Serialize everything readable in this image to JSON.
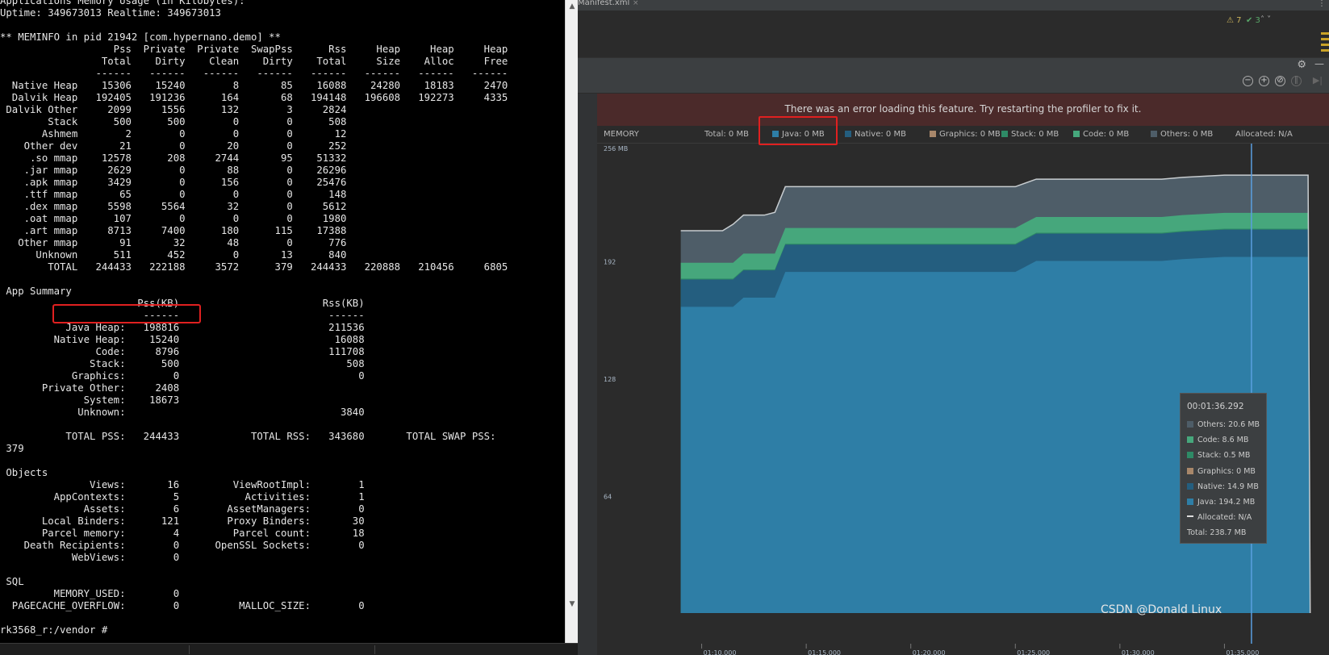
{
  "terminal": {
    "lines": [
      "Applications Memory Usage (in Kilobytes):",
      "Uptime: 349673013 Realtime: 349673013",
      "",
      "** MEMINFO in pid 21942 [com.hypernano.demo] **",
      "                   Pss  Private  Private  SwapPss      Rss     Heap     Heap     Heap",
      "                 Total    Dirty    Clean    Dirty    Total     Size    Alloc     Free",
      "                ------   ------   ------   ------   ------   ------   ------   ------",
      "  Native Heap    15306    15240        8       85    16088    24280    18183     2470",
      "  Dalvik Heap   192405   191236      164       68   194148   196608   192273     4335",
      " Dalvik Other     2099     1556      132        3     2824",
      "        Stack      500      500        0        0      508",
      "       Ashmem        2        0        0        0       12",
      "    Other dev       21        0       20        0      252",
      "     .so mmap    12578      208     2744       95    51332",
      "    .jar mmap     2629        0       88        0    26296",
      "    .apk mmap     3429        0      156        0    25476",
      "    .ttf mmap       65        0        0        0      148",
      "    .dex mmap     5598     5564       32        0     5612",
      "    .oat mmap      107        0        0        0     1980",
      "    .art mmap     8713     7400      180      115    17388",
      "   Other mmap       91       32       48        0      776",
      "      Unknown      511      452        0       13      840",
      "        TOTAL   244433   222188     3572      379   244433   220888   210456     6805",
      "",
      " App Summary",
      "                       Pss(KB)                        Rss(KB)",
      "                        ------                         ------",
      "           Java Heap:   198816                         211536",
      "         Native Heap:    15240                          16088",
      "                Code:     8796                         111708",
      "               Stack:      500                            508",
      "            Graphics:        0                              0",
      "       Private Other:     2408",
      "              System:    18673",
      "             Unknown:                                    3840",
      "",
      "           TOTAL PSS:   244433            TOTAL RSS:   343680       TOTAL SWAP PSS:",
      " 379",
      "",
      " Objects",
      "               Views:       16         ViewRootImpl:        1",
      "         AppContexts:        5           Activities:        1",
      "              Assets:        6        AssetManagers:        0",
      "       Local Binders:      121        Proxy Binders:       30",
      "       Parcel memory:        4         Parcel count:       18",
      "    Death Recipients:        0      OpenSSL Sockets:        0",
      "            WebViews:        0",
      "",
      " SQL",
      "         MEMORY_USED:        0",
      "  PAGECACHE_OVERFLOW:        0          MALLOC_SIZE:        0",
      "",
      "rk3568_r:/vendor #"
    ]
  },
  "ide": {
    "tab_label": "Manifest.xml",
    "tab_close": "×",
    "tab_more": "⋮",
    "warnings": "⚠ 7",
    "ok": "✔ 3",
    "nav_arrows": "˄ ˅",
    "gear": "⚙",
    "minimize": "—",
    "zoom_out": "−",
    "zoom_in": "+",
    "reset_zoom": "⊘",
    "pause": "∥",
    "go_live": "▶|"
  },
  "profiler": {
    "error_message": "There was an error loading this feature. Try restarting the profiler to fix it.",
    "legend": {
      "memory": "MEMORY",
      "total": "Total: 0 MB",
      "java": "Java: 0 MB",
      "native": "Native: 0 MB",
      "graphics": "Graphics: 0 MB",
      "stack": "Stack: 0 MB",
      "code": "Code: 0 MB",
      "others": "Others: 0 MB",
      "allocated": "Allocated: N/A"
    },
    "colors": {
      "java": "#2e7ea6",
      "native": "#245e7f",
      "stack": "#2e8a66",
      "code": "#46a77c",
      "graphics": "#a8876a",
      "others": "#4e5d68"
    },
    "tooltip": {
      "time": "00:01:36.292",
      "others": "Others: 20.6 MB",
      "code": "Code: 8.6 MB",
      "stack": "Stack: 0.5 MB",
      "graphics": "Graphics: 0 MB",
      "native": "Native: 14.9 MB",
      "java": "Java: 194.2 MB",
      "allocated": "Allocated: N/A",
      "total": "Total: 238.7 MB"
    }
  },
  "chart_data": {
    "type": "area",
    "ylim": [
      0,
      256
    ],
    "y_ticks": [
      "256 MB",
      "192",
      "128",
      "64"
    ],
    "x_ticks": [
      "01:10.000",
      "01:15.000",
      "01:20.000",
      "01:25.000",
      "01:30.000",
      "01:35.000"
    ],
    "x_seconds": [
      69.0,
      70.0,
      71.0,
      71.5,
      72.0,
      72.4,
      73.0,
      73.5,
      74.0,
      75.0,
      85.0,
      86.0,
      92.0,
      93.0,
      95.0,
      95.5,
      96.0,
      97.0,
      99.0,
      99.1
    ],
    "series": [
      {
        "name": "Java",
        "values": [
          167,
          167,
          167,
          167,
          172,
          172,
          172,
          172,
          186,
          186,
          186,
          192,
          192,
          193,
          194.2,
          194.2,
          194.2,
          194.2,
          194.2,
          0
        ]
      },
      {
        "name": "Native",
        "values": [
          14.9,
          14.9,
          14.9,
          14.9,
          14.9,
          14.9,
          14.9,
          14.9,
          14.9,
          14.9,
          14.9,
          14.9,
          14.9,
          14.9,
          14.9,
          14.9,
          14.9,
          14.9,
          14.9,
          0
        ]
      },
      {
        "name": "Stack",
        "values": [
          0.5,
          0.5,
          0.5,
          0.5,
          0.5,
          0.5,
          0.5,
          0.5,
          0.5,
          0.5,
          0.5,
          0.5,
          0.5,
          0.5,
          0.5,
          0.5,
          0.5,
          0.5,
          0.5,
          0
        ]
      },
      {
        "name": "Code",
        "values": [
          8.6,
          8.6,
          8.6,
          8.6,
          8.6,
          8.6,
          8.6,
          8.6,
          8.6,
          8.6,
          8.6,
          8.6,
          8.6,
          8.6,
          8.6,
          8.6,
          8.6,
          8.6,
          8.6,
          0
        ]
      },
      {
        "name": "Others",
        "values": [
          17.5,
          17.5,
          17.5,
          21,
          21,
          21,
          21,
          22.5,
          22.5,
          22.5,
          22.5,
          20.6,
          20.6,
          20.6,
          20.6,
          20.6,
          20.6,
          20.6,
          20.6,
          0
        ]
      }
    ],
    "cursor_time": "00:01:36.292",
    "cursor_seconds": 96.292
  },
  "watermark": "CSDN @Donald Linux"
}
